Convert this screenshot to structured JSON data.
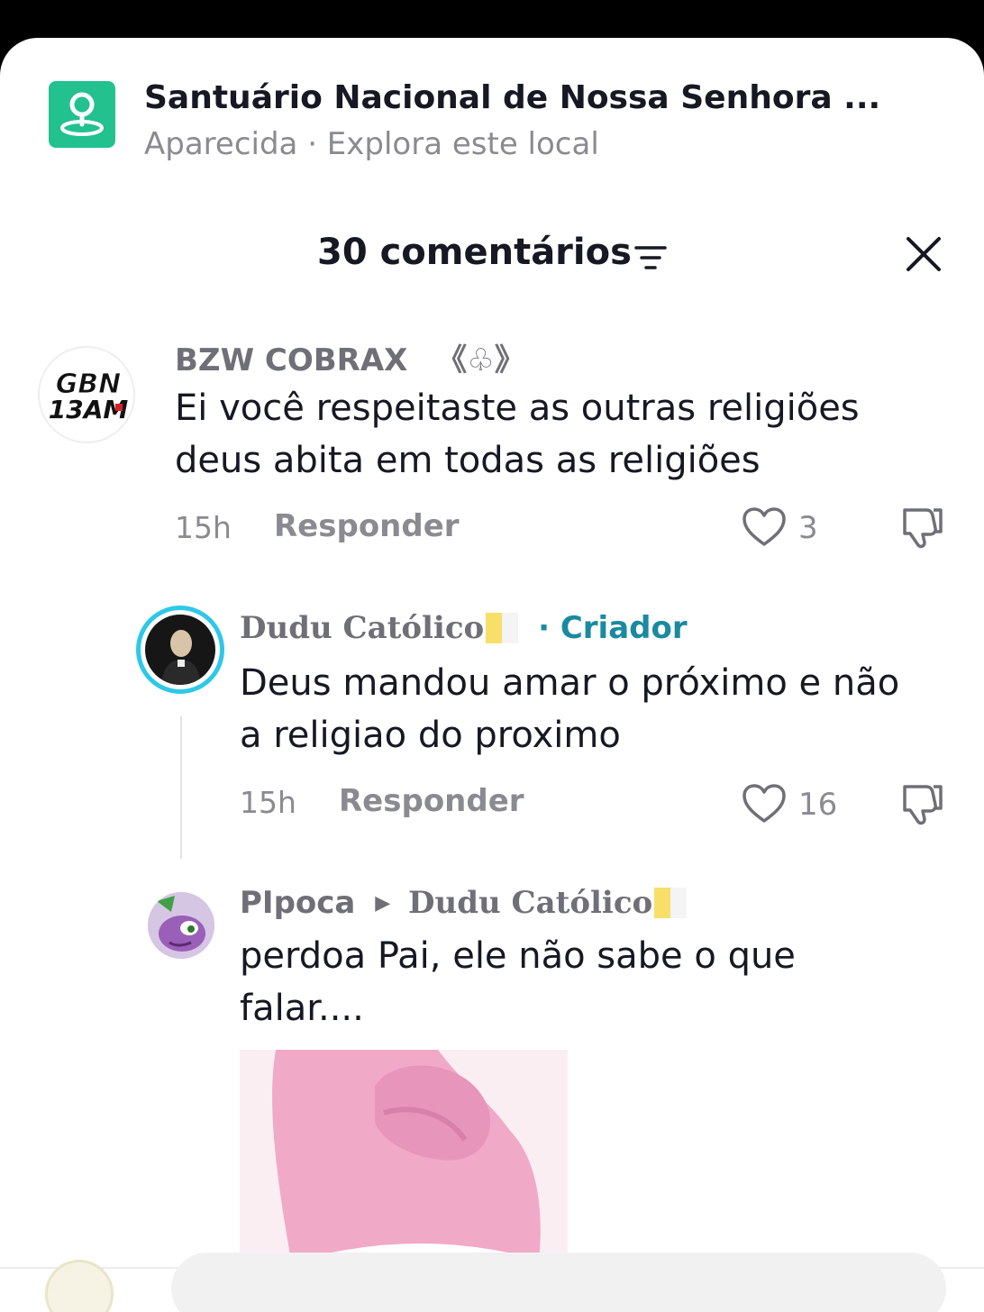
{
  "location": {
    "icon": "location-pin-icon",
    "title": "Santuário Nacional de Nossa Senhora ...",
    "subtitle": "Aparecida · Explora este local"
  },
  "header": {
    "title": "30 comentários",
    "filter_icon": "filter-icon",
    "close_icon": "close-icon"
  },
  "comments": [
    {
      "author": "BZW COBRAX",
      "author_badge": "《♧》",
      "avatar_text": "GBN 13AM",
      "text_line1": "Ei você respeitaste as outras religiões",
      "text_line2": "deus abita em todas as religiões",
      "time": "15h",
      "reply_label": "Responder",
      "likes": "3"
    },
    {
      "author": "Dudu Católico",
      "creator_tag": "· Criador",
      "text_line1": "Deus mandou amar o próximo e não",
      "text_line2": "a religiao do proximo",
      "time": "15h",
      "reply_label": "Responder",
      "likes": "16"
    },
    {
      "author": "PIpoca",
      "reply_to": "Dudu Católico",
      "text_line1": "perdoa Pai, ele não sabe o que",
      "text_line2": "falar...."
    }
  ],
  "colors": {
    "accent_creator": "#1a8aa0",
    "location_icon_bg": "#22c18e",
    "secondary_text": "#8a8b91"
  }
}
